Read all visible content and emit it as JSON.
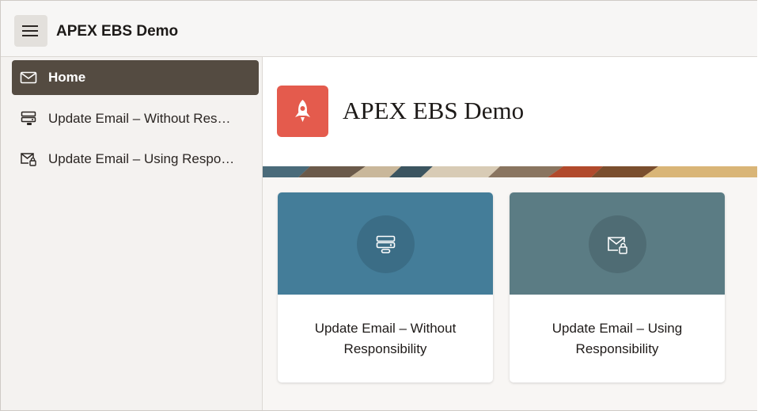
{
  "app": {
    "title": "APEX EBS Demo"
  },
  "header": {
    "menu_icon": "hamburger-menu-icon"
  },
  "sidebar": {
    "items": [
      {
        "label": "Home",
        "icon": "envelope-icon",
        "active": true
      },
      {
        "label": "Update Email – Without Res…",
        "icon": "server-stack-icon",
        "active": false
      },
      {
        "label": "Update Email – Using Respo…",
        "icon": "envelope-lock-icon",
        "active": false
      }
    ]
  },
  "hero": {
    "title": "APEX EBS Demo",
    "icon": "rocket-icon",
    "icon_color": "#e45b4d"
  },
  "cards": [
    {
      "label": "Update Email – Without Responsibility",
      "icon": "server-stack-icon",
      "color": "#447d99"
    },
    {
      "label": "Update Email – Using Responsibility",
      "icon": "envelope-lock-icon",
      "color": "#5b7c84"
    }
  ],
  "colors": {
    "active_nav": "#544b41",
    "header_bg": "#f7f6f5",
    "sidebar_bg": "#f4f2f0"
  }
}
